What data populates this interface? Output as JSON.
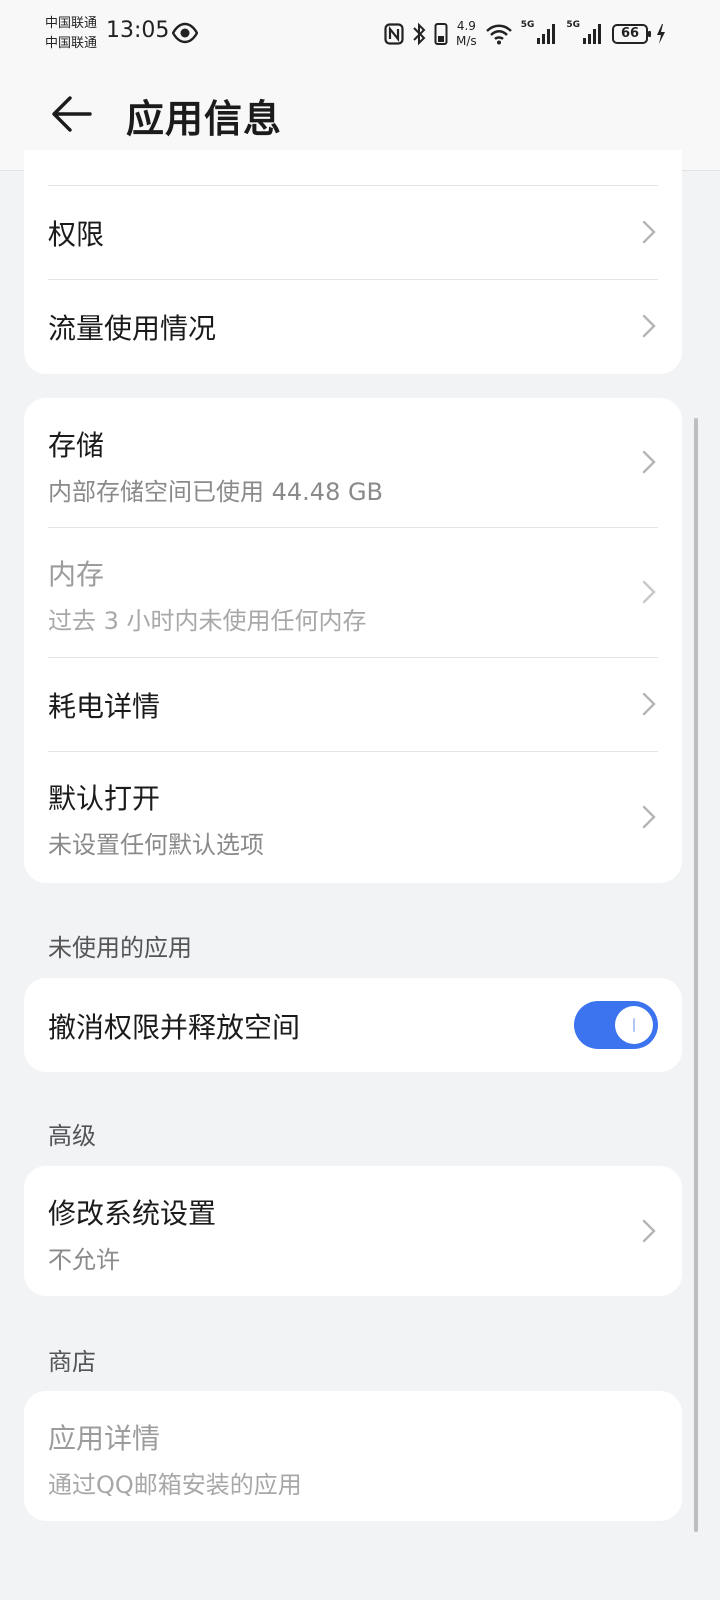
{
  "status_bar": {
    "carrier_1": "中国联通",
    "carrier_2": "中国联通",
    "time": "13:05",
    "speed_value": "4.9",
    "speed_unit": "M/s",
    "sig1": "5G",
    "sig2": "5G",
    "battery": "66",
    "icons": [
      "eye-icon",
      "nfc-icon",
      "bluetooth-icon",
      "phone-icon",
      "wifi-icon",
      "signal-icon",
      "battery-icon",
      "charging-icon"
    ]
  },
  "header": {
    "title": "应用信息",
    "back_icon": "arrow-left-icon"
  },
  "card1": {
    "items": [
      {
        "label": "权限"
      },
      {
        "label": "流量使用情况"
      }
    ]
  },
  "card2": {
    "items": [
      {
        "label": "存储",
        "sub": "内部存储空间已使用 44.48 GB"
      },
      {
        "label": "内存",
        "sub": "过去 3 小时内未使用任何内存",
        "disabled": true
      },
      {
        "label": "耗电详情"
      },
      {
        "label": "默认打开",
        "sub": "未设置任何默认选项"
      }
    ]
  },
  "section_unused": {
    "header": "未使用的应用",
    "toggle_label": "撤消权限并释放空间",
    "toggle_on": true
  },
  "section_advanced": {
    "header": "高级",
    "label": "修改系统设置",
    "sub": "不允许"
  },
  "section_store": {
    "header": "商店",
    "label": "应用详情",
    "sub": "通过QQ邮箱安装的应用",
    "disabled": true
  },
  "colors": {
    "accent": "#3c74f0",
    "background": "#f1f3f5",
    "card": "#ffffff"
  }
}
